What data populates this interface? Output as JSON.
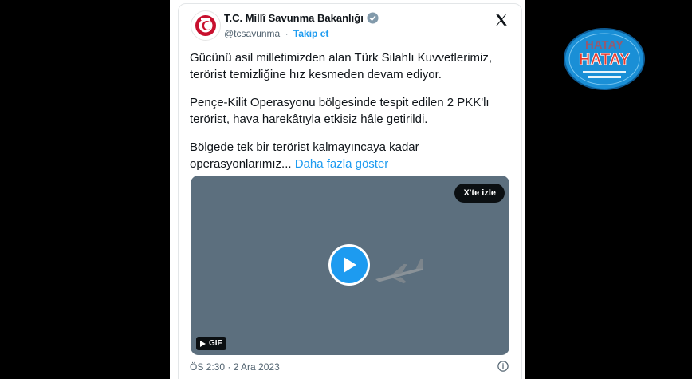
{
  "account": {
    "name": "T.C. Millî Savunma Bakanlığı",
    "handle": "@tcsavunma",
    "separator": "·",
    "follow_label": "Takip et"
  },
  "tweet": {
    "paragraphs": [
      "Gücünü asil milletimizden alan Türk Silahlı Kuvvetlerimiz, terörist temizliğine hız kesmeden devam ediyor.",
      "Pençe-Kilit Operasyonu bölgesinde tespit edilen 2 PKK'lı terörist, hava harekâtıyla etkisiz hâle getirildi."
    ],
    "last_paragraph": "Bölgede tek bir terörist kalmayıncaya kadar operasyonlarımız...",
    "more_label": "Daha fazla göster"
  },
  "media": {
    "watch_label": "X'te izle",
    "gif_label": "GIF"
  },
  "meta": {
    "timestamp": "ÖS 2:30 · 2 Ara 2023"
  },
  "watermark": {
    "text": "HATAY"
  },
  "colors": {
    "accent": "#1d9bf0",
    "media_bg": "#5c6f7e",
    "logo_bg": "#1a8fd6",
    "logo_text": "#e53a2f"
  }
}
